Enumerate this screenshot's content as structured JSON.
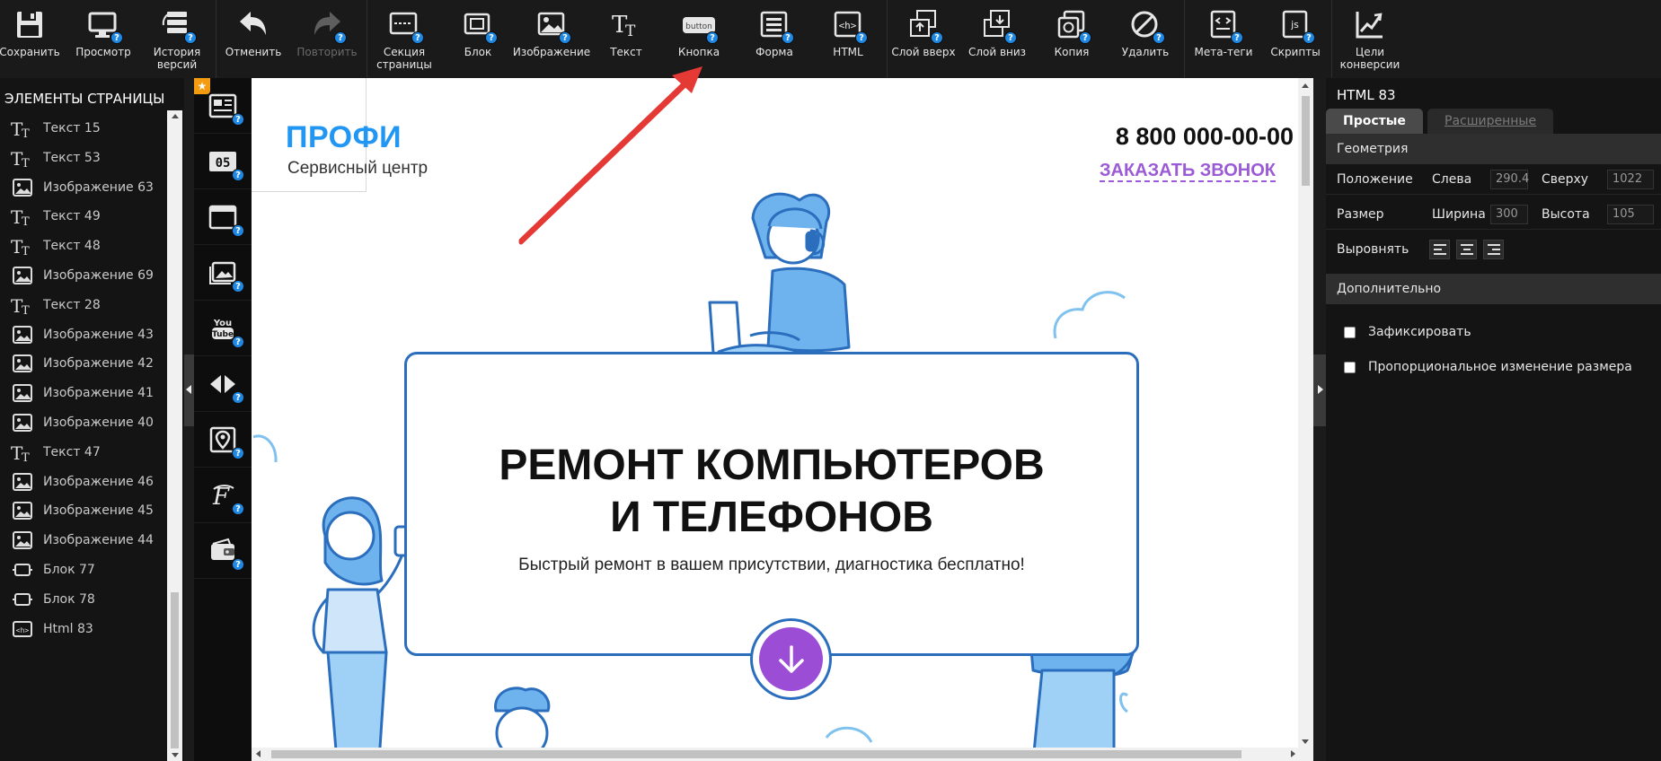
{
  "toolbar": {
    "save": "Сохранить",
    "preview": "Просмотр",
    "history": "История\nверсий",
    "undo": "Отменить",
    "redo": "Повторить",
    "section": "Секция\nстраницы",
    "block": "Блок",
    "image": "Изображение",
    "text": "Текст",
    "button": "Кнопка",
    "button_icon_text": "button",
    "form": "Форма",
    "html": "HTML",
    "layer_up": "Слой вверх",
    "layer_down": "Слой вниз",
    "copy": "Копия",
    "delete": "Удалить",
    "meta": "Мета-теги",
    "scripts": "Скрипты",
    "goals": "Цели\nконверсии",
    "help_glyph": "?"
  },
  "left_panel": {
    "title": "ЭЛЕМЕНТЫ СТРАНИЦЫ",
    "items": [
      {
        "type": "text",
        "label": "Текст 15"
      },
      {
        "type": "text",
        "label": "Текст 53"
      },
      {
        "type": "image",
        "label": "Изображение 63"
      },
      {
        "type": "text",
        "label": "Текст 49"
      },
      {
        "type": "text",
        "label": "Текст 48"
      },
      {
        "type": "image",
        "label": "Изображение 69"
      },
      {
        "type": "text",
        "label": "Текст 28"
      },
      {
        "type": "image",
        "label": "Изображение 43"
      },
      {
        "type": "image",
        "label": "Изображение 42"
      },
      {
        "type": "image",
        "label": "Изображение 41"
      },
      {
        "type": "image",
        "label": "Изображение 40"
      },
      {
        "type": "text",
        "label": "Текст 47"
      },
      {
        "type": "image",
        "label": "Изображение 46"
      },
      {
        "type": "image",
        "label": "Изображение 45"
      },
      {
        "type": "image",
        "label": "Изображение 44"
      },
      {
        "type": "block",
        "label": "Блок 77"
      },
      {
        "type": "block",
        "label": "Блок 78"
      },
      {
        "type": "html",
        "label": "Html 83"
      }
    ]
  },
  "widgets": {
    "star": "★",
    "timer_text": "05"
  },
  "canvas": {
    "logo": "ПРОФИ",
    "logo_sub": "Сервисный центр",
    "phone": "8 800 000-00-00",
    "callback": "ЗАКАЗАТЬ ЗВОНОК",
    "hero_title_line1": "РЕМОНТ КОМПЬЮТЕРОВ",
    "hero_title_line2": "И ТЕЛЕФОНОВ",
    "hero_sub": "Быстрый ремонт в вашем присутствии, диагностика бесплатно!"
  },
  "right_panel": {
    "title": "HTML 83",
    "tab_simple": "Простые",
    "tab_advanced": "Расширенные",
    "geometry": "Геометрия",
    "position_label": "Положение",
    "left_label": "Слева",
    "left_value": "290.4",
    "top_label": "Сверху",
    "top_value": "1022",
    "size_label": "Размер",
    "width_label": "Ширина",
    "width_value": "300",
    "height_label": "Высота",
    "height_value": "105",
    "align_label": "Выровнять",
    "extra": "Дополнительно",
    "fix": "Зафиксировать",
    "proportional": "Пропорциональное изменение размера"
  },
  "colors": {
    "accent_blue": "#2196f3",
    "purple": "#9c4dd6",
    "arrow_red": "#e53935",
    "help_badge": "#1e88e5"
  }
}
